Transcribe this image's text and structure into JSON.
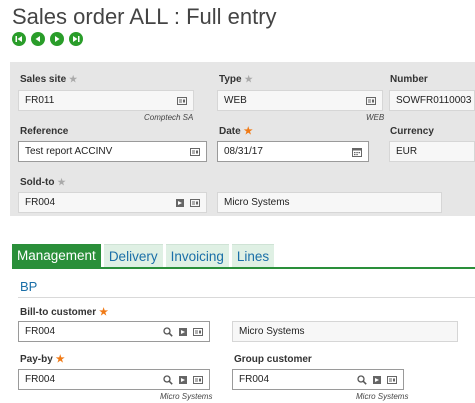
{
  "page": {
    "title": "Sales order ALL : Full entry"
  },
  "nav": {
    "buttons": [
      "first-icon",
      "previous-icon",
      "next-icon",
      "last-icon"
    ]
  },
  "header": {
    "sales_site": {
      "label": "Sales site",
      "value": "FR011",
      "sub": "Comptech SA"
    },
    "type": {
      "label": "Type",
      "value": "WEB",
      "sub": "WEB"
    },
    "number": {
      "label": "Number",
      "value": "SOWFR0110003"
    },
    "reference": {
      "label": "Reference",
      "value": "Test report ACCINV"
    },
    "date": {
      "label": "Date",
      "value": "08/31/17"
    },
    "currency": {
      "label": "Currency",
      "value": "EUR"
    },
    "sold_to": {
      "label": "Sold-to",
      "value": "FR004",
      "name": "Micro Systems"
    }
  },
  "tabs": [
    {
      "label": "Management",
      "active": true
    },
    {
      "label": "Delivery",
      "active": false
    },
    {
      "label": "Invoicing",
      "active": false
    },
    {
      "label": "Lines",
      "active": false
    }
  ],
  "section": {
    "title": "BP",
    "bill_to": {
      "label": "Bill-to customer",
      "value": "FR004",
      "name": "Micro Systems"
    },
    "pay_by": {
      "label": "Pay-by",
      "value": "FR004",
      "sub": "Micro Systems"
    },
    "group_customer": {
      "label": "Group customer",
      "value": "FR004",
      "sub": "Micro Systems"
    }
  },
  "colors": {
    "accent_green": "#2a8f3a",
    "link_blue": "#1a6fa8",
    "required_star": "#f07a16"
  }
}
